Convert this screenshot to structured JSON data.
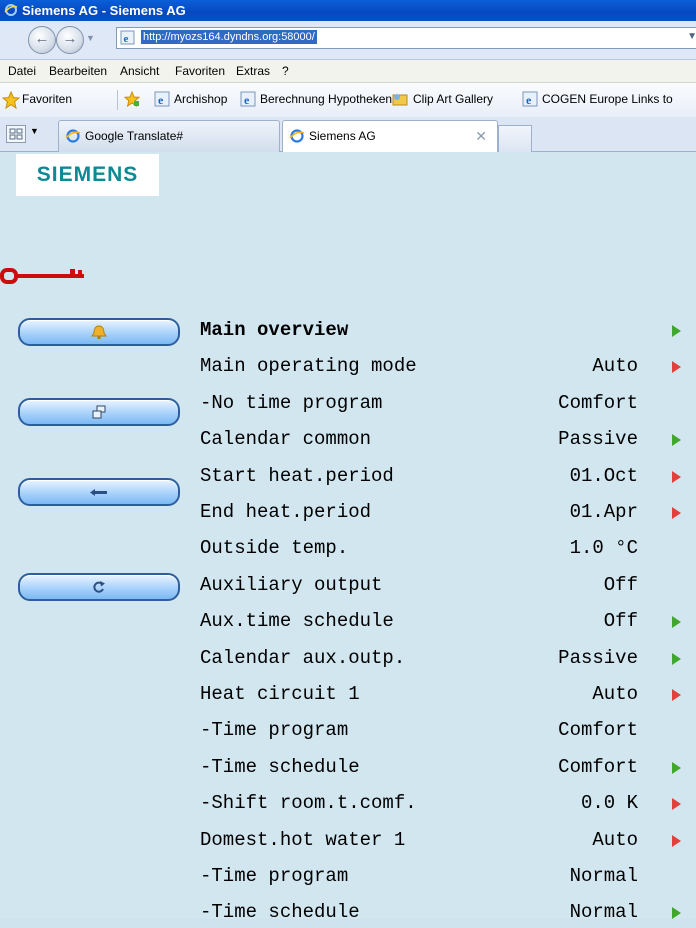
{
  "window": {
    "title": "Siemens AG - Siemens AG"
  },
  "address": {
    "url": "http://myozs164.dyndns.org:58000/"
  },
  "menu": [
    "Datei",
    "Bearbeiten",
    "Ansicht",
    "Favoriten",
    "Extras",
    "?"
  ],
  "favorites": {
    "label": "Favoriten",
    "items": [
      "Archishop",
      "Berechnung Hypotheken",
      "Clip Art Gallery",
      "COGEN Europe Links to"
    ]
  },
  "tabs": [
    {
      "label": "Google Translate#"
    },
    {
      "label": "Siemens AG"
    }
  ],
  "page": {
    "logo": "SIEMENS",
    "sidebar_icons": [
      "bell-icon",
      "windows-icon",
      "back-arrow-icon",
      "refresh-icon"
    ],
    "rows": [
      {
        "label": "Main overview",
        "value": "",
        "arrow": "green",
        "bold": true
      },
      {
        "label": "Main operating mode",
        "value": "Auto",
        "arrow": "red"
      },
      {
        "label": "-No time program",
        "value": "Comfort",
        "arrow": ""
      },
      {
        "label": "Calendar common",
        "value": "Passive",
        "arrow": "green"
      },
      {
        "label": "Start heat.period",
        "value": "01.Oct",
        "arrow": "red"
      },
      {
        "label": "End heat.period",
        "value": "01.Apr",
        "arrow": "red"
      },
      {
        "label": "Outside temp.",
        "value": "1.0 °C",
        "arrow": ""
      },
      {
        "label": "Auxiliary output",
        "value": "Off",
        "arrow": ""
      },
      {
        "label": "Aux.time schedule",
        "value": "Off",
        "arrow": "green"
      },
      {
        "label": "Calendar aux.outp.",
        "value": "Passive",
        "arrow": "green"
      },
      {
        "label": "Heat circuit 1",
        "value": "Auto",
        "arrow": "red"
      },
      {
        "label": "-Time program",
        "value": "Comfort",
        "arrow": ""
      },
      {
        "label": "-Time schedule",
        "value": "Comfort",
        "arrow": "green"
      },
      {
        "label": "-Shift room.t.comf.",
        "value": "0.0 K",
        "arrow": "red"
      },
      {
        "label": "Domest.hot water 1",
        "value": "Auto",
        "arrow": "red"
      },
      {
        "label": "-Time program",
        "value": "Normal",
        "arrow": ""
      },
      {
        "label": "-Time schedule",
        "value": "Normal",
        "arrow": "green"
      }
    ]
  }
}
